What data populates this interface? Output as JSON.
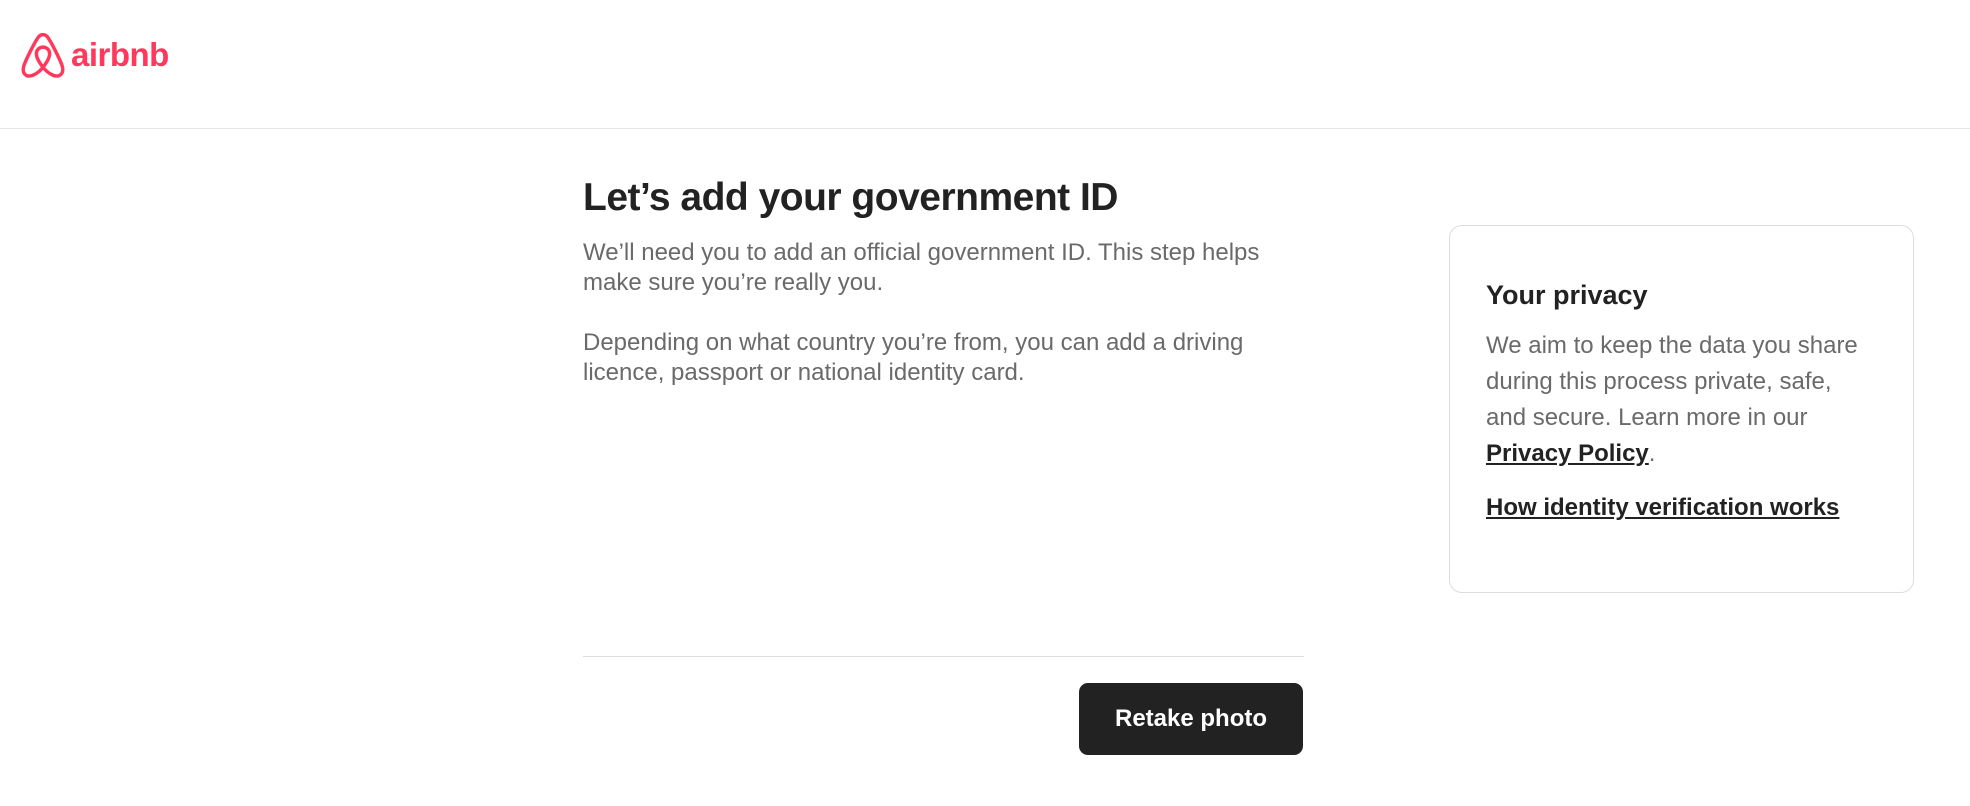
{
  "brand": {
    "name": "airbnb",
    "color": "#ff385c",
    "icon": "airbnb-logo-icon"
  },
  "main": {
    "title": "Let’s add your government ID",
    "paragraphs": [
      "We’ll need you to add an official government ID. This step helps make sure you’re really you.",
      "Depending on what country you’re from, you can add a driving licence, passport or national identity card."
    ]
  },
  "privacy": {
    "title": "Your privacy",
    "text": "We aim to keep the data you share during this process private, safe, and secure. Learn more in our ",
    "policy_link": "Privacy Policy",
    "period": ".",
    "how_link": "How identity verification works"
  },
  "actions": {
    "retake_label": "Retake photo"
  },
  "colors": {
    "button_bg": "#222222",
    "text_primary": "#222222",
    "text_secondary": "#6a6a6a"
  }
}
